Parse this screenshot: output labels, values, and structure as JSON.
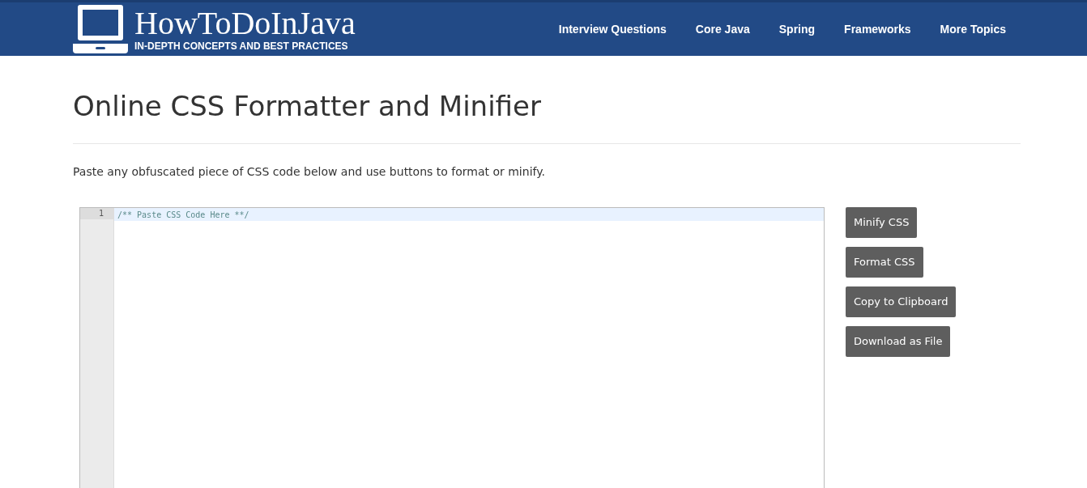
{
  "header": {
    "logo_title": "HowToDoInJava",
    "logo_tagline": "IN-DEPTH CONCEPTS AND BEST PRACTICES",
    "nav": [
      "Interview Questions",
      "Core Java",
      "Spring",
      "Frameworks",
      "More Topics"
    ]
  },
  "page": {
    "title": "Online CSS Formatter and Minifier",
    "intro": "Paste any obfuscated piece of CSS code below and use buttons to format or minify."
  },
  "editor": {
    "lines": [
      {
        "number": "1",
        "code": "/** Paste CSS Code Here **/"
      }
    ]
  },
  "buttons": [
    "Minify CSS",
    "Format CSS",
    "Copy to Clipboard",
    "Download as File"
  ]
}
